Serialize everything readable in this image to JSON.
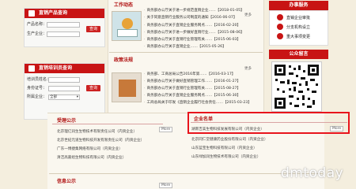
{
  "left": {
    "product_query": {
      "title": "直销产品查询",
      "product_name_label": "产品名称：",
      "manufacturer_label": "生产企业：",
      "query_button": "查询"
    },
    "staff_query": {
      "title": "直销培训员查询",
      "trainer_label": "培训员姓名：",
      "id_label": "身份证号：",
      "company_label": "所属企业：",
      "company_value": "全部",
      "query_button": "查询"
    }
  },
  "center": {
    "news_title": "工作动态",
    "news_more": "更多",
    "news_items": [
      "商务部办公厅关于进一步规范直销企业……【2018-01-05】",
      "关于同意直销行业服务公司制度的通知【2016-06-07】",
      "商务部办公厅关于直销企业服务网点……【2016-02-20】",
      "商务部办公厅关于进一步做好直销行业……【2015-08-06】",
      "商务部办公厅关于直销行业管理有关……【2015-06-03】",
      "商务部办公厅关于直销企业……【2015-05-26】"
    ],
    "policy_title": "政策法规",
    "policy_more": "更多",
    "policy_items": [
      "商务部、工商总局公告2016年第……【2016-03-17】",
      "商务部办公厅关于做好直销管理工作……【2016-01-27】",
      "商务部办公厅关于直销行业管理有关……【2015-08-27】",
      "商务部办公厅关于直销企业服务网点……【2015-06-30】",
      "工商总局关于印发《直销企业履行社会责任……【2015-03-23】"
    ]
  },
  "right": {
    "service_title": "办事服务",
    "service_items": [
      "直销企业审批",
      "分支机构设立",
      "重大事项变更"
    ],
    "wechat_title": "公众留言"
  },
  "bottom": {
    "accept_title": "受理公示",
    "accept_more": "More",
    "accept_items": [
      "北京理亿润生生物技术有限责任公司（内资企业）",
      "北京世纪元道生物科技开发有限责任公司（内资企业）",
      "广东一博捷集网络有限公司（内资企业）",
      "清洁高嘉组生物科技有限公司（内资企业）"
    ],
    "company_title": "企业名单",
    "company_more": "More",
    "company_items": [
      "湖南吉美生物科技发展有限公司（内资企业）",
      "北京同仁堂健康药业股份有限公司（内资企业）",
      "山东蓝宝生物科技有限公司（内资企业）",
      "山东绿加润生物技术有限公司（内资企业）"
    ],
    "info_title": "信息公示",
    "info_more": "More"
  },
  "watermark": "dmtoday",
  "colors": {
    "brand_red": "#c81414",
    "highlight": "#e8141c",
    "background": "#f4eede"
  }
}
